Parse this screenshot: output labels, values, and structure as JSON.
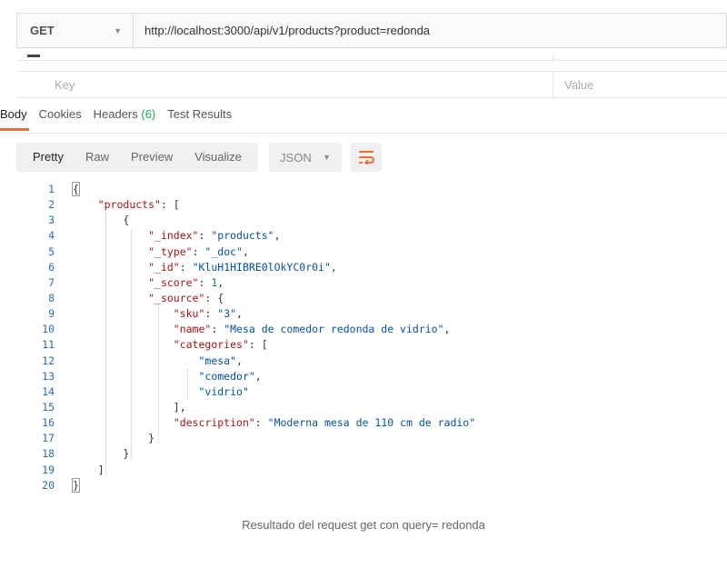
{
  "request": {
    "method": "GET",
    "url": "http://localhost:3000/api/v1/products?product=redonda"
  },
  "params": {
    "key_placeholder": "Key",
    "value_placeholder": "Value"
  },
  "response_tabs": [
    {
      "label": "Body",
      "active": true
    },
    {
      "label": "Cookies"
    },
    {
      "label": "Headers",
      "count": "(6)"
    },
    {
      "label": "Test Results"
    }
  ],
  "format_toolbar": {
    "modes": [
      "Pretty",
      "Raw",
      "Preview",
      "Visualize"
    ],
    "active_mode": "Pretty",
    "language": "JSON",
    "wrap_icon": "wrap-lines-icon"
  },
  "code_lines": [
    "{",
    "    \"products\": [",
    "        {",
    "            \"_index\": \"products\",",
    "            \"_type\": \"_doc\",",
    "            \"_id\": \"KluH1HIBRE0lOkYC0r0i\",",
    "            \"_score\": 1,",
    "            \"_source\": {",
    "                \"sku\": \"3\",",
    "                \"name\": \"Mesa de comedor redonda de vidrio\",",
    "                \"categories\": [",
    "                    \"mesa\",",
    "                    \"comedor\",",
    "                    \"vidrio\"",
    "                ],",
    "                \"description\": \"Moderna mesa de 110 cm de radio\"",
    "            }",
    "        }",
    "    ]",
    "}"
  ],
  "caption": "Resultado del request get con query= redonda",
  "colors": {
    "accent": "#f26b3a",
    "headers_count": "#26a65b",
    "line_numbers": "#2a6bb5",
    "json_key": "#a31515",
    "json_string": "#0451a5",
    "json_number": "#098658"
  }
}
